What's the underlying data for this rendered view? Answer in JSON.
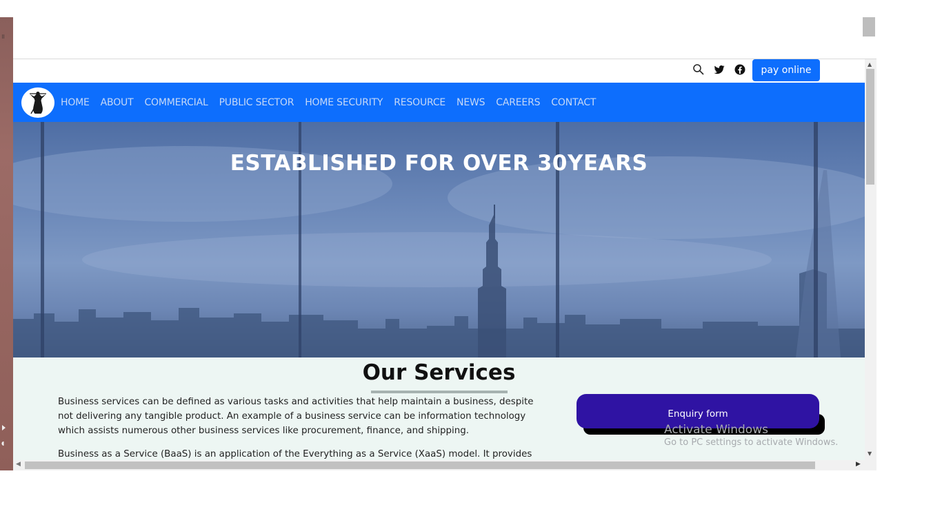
{
  "utility_bar": {
    "icons": [
      "search-icon",
      "twitter-icon",
      "facebook-icon"
    ],
    "pay_label": "pay online"
  },
  "nav": {
    "logo": "lady-justice-logo",
    "items": [
      "HOME",
      "ABOUT",
      "COMMERCIAL",
      "PUBLIC SECTOR",
      "HOME SECURITY",
      "RESOURCE",
      "NEWS",
      "CAREERS",
      "CONTACT"
    ]
  },
  "hero": {
    "title": "ESTABLISHED FOR OVER 30YEARS"
  },
  "services": {
    "title": "Our Services",
    "paragraph_1": "Business services can be defined as various tasks and activities that help maintain a business, despite not delivering any tangible product. An example of a business service can be information technology which assists numerous other business services like procurement, finance, and shipping.",
    "paragraph_2": "Business as a Service (BaaS) is an application of the Everything as a Service (XaaS) model. It provides",
    "enquiry_label": "Enquiry form"
  },
  "watermark": {
    "title": "Activate Windows",
    "subtitle": "Go to PC settings to activate Windows."
  },
  "colors": {
    "nav_blue": "#0d6efd",
    "enquiry_purple": "#2f13a3",
    "services_bg": "#edf6f3"
  }
}
